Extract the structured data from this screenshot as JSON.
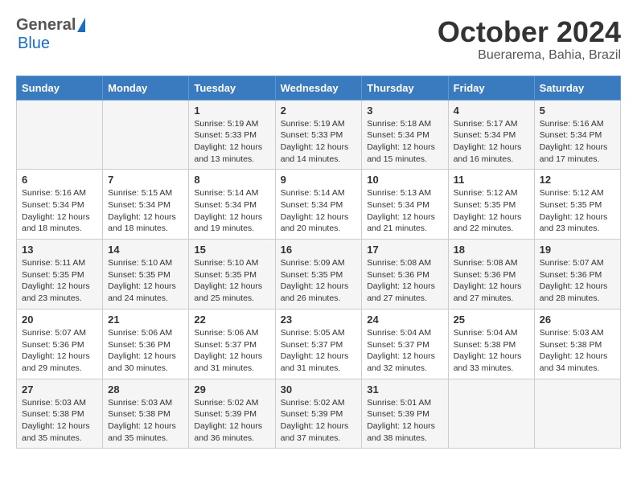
{
  "logo": {
    "general": "General",
    "blue": "Blue"
  },
  "header": {
    "title": "October 2024",
    "subtitle": "Buerarema, Bahia, Brazil"
  },
  "days_of_week": [
    "Sunday",
    "Monday",
    "Tuesday",
    "Wednesday",
    "Thursday",
    "Friday",
    "Saturday"
  ],
  "weeks": [
    [
      {
        "day": "",
        "sunrise": "",
        "sunset": "",
        "daylight": ""
      },
      {
        "day": "",
        "sunrise": "",
        "sunset": "",
        "daylight": ""
      },
      {
        "day": "1",
        "sunrise": "Sunrise: 5:19 AM",
        "sunset": "Sunset: 5:33 PM",
        "daylight": "Daylight: 12 hours and 13 minutes."
      },
      {
        "day": "2",
        "sunrise": "Sunrise: 5:19 AM",
        "sunset": "Sunset: 5:33 PM",
        "daylight": "Daylight: 12 hours and 14 minutes."
      },
      {
        "day": "3",
        "sunrise": "Sunrise: 5:18 AM",
        "sunset": "Sunset: 5:34 PM",
        "daylight": "Daylight: 12 hours and 15 minutes."
      },
      {
        "day": "4",
        "sunrise": "Sunrise: 5:17 AM",
        "sunset": "Sunset: 5:34 PM",
        "daylight": "Daylight: 12 hours and 16 minutes."
      },
      {
        "day": "5",
        "sunrise": "Sunrise: 5:16 AM",
        "sunset": "Sunset: 5:34 PM",
        "daylight": "Daylight: 12 hours and 17 minutes."
      }
    ],
    [
      {
        "day": "6",
        "sunrise": "Sunrise: 5:16 AM",
        "sunset": "Sunset: 5:34 PM",
        "daylight": "Daylight: 12 hours and 18 minutes."
      },
      {
        "day": "7",
        "sunrise": "Sunrise: 5:15 AM",
        "sunset": "Sunset: 5:34 PM",
        "daylight": "Daylight: 12 hours and 18 minutes."
      },
      {
        "day": "8",
        "sunrise": "Sunrise: 5:14 AM",
        "sunset": "Sunset: 5:34 PM",
        "daylight": "Daylight: 12 hours and 19 minutes."
      },
      {
        "day": "9",
        "sunrise": "Sunrise: 5:14 AM",
        "sunset": "Sunset: 5:34 PM",
        "daylight": "Daylight: 12 hours and 20 minutes."
      },
      {
        "day": "10",
        "sunrise": "Sunrise: 5:13 AM",
        "sunset": "Sunset: 5:34 PM",
        "daylight": "Daylight: 12 hours and 21 minutes."
      },
      {
        "day": "11",
        "sunrise": "Sunrise: 5:12 AM",
        "sunset": "Sunset: 5:35 PM",
        "daylight": "Daylight: 12 hours and 22 minutes."
      },
      {
        "day": "12",
        "sunrise": "Sunrise: 5:12 AM",
        "sunset": "Sunset: 5:35 PM",
        "daylight": "Daylight: 12 hours and 23 minutes."
      }
    ],
    [
      {
        "day": "13",
        "sunrise": "Sunrise: 5:11 AM",
        "sunset": "Sunset: 5:35 PM",
        "daylight": "Daylight: 12 hours and 23 minutes."
      },
      {
        "day": "14",
        "sunrise": "Sunrise: 5:10 AM",
        "sunset": "Sunset: 5:35 PM",
        "daylight": "Daylight: 12 hours and 24 minutes."
      },
      {
        "day": "15",
        "sunrise": "Sunrise: 5:10 AM",
        "sunset": "Sunset: 5:35 PM",
        "daylight": "Daylight: 12 hours and 25 minutes."
      },
      {
        "day": "16",
        "sunrise": "Sunrise: 5:09 AM",
        "sunset": "Sunset: 5:35 PM",
        "daylight": "Daylight: 12 hours and 26 minutes."
      },
      {
        "day": "17",
        "sunrise": "Sunrise: 5:08 AM",
        "sunset": "Sunset: 5:36 PM",
        "daylight": "Daylight: 12 hours and 27 minutes."
      },
      {
        "day": "18",
        "sunrise": "Sunrise: 5:08 AM",
        "sunset": "Sunset: 5:36 PM",
        "daylight": "Daylight: 12 hours and 27 minutes."
      },
      {
        "day": "19",
        "sunrise": "Sunrise: 5:07 AM",
        "sunset": "Sunset: 5:36 PM",
        "daylight": "Daylight: 12 hours and 28 minutes."
      }
    ],
    [
      {
        "day": "20",
        "sunrise": "Sunrise: 5:07 AM",
        "sunset": "Sunset: 5:36 PM",
        "daylight": "Daylight: 12 hours and 29 minutes."
      },
      {
        "day": "21",
        "sunrise": "Sunrise: 5:06 AM",
        "sunset": "Sunset: 5:36 PM",
        "daylight": "Daylight: 12 hours and 30 minutes."
      },
      {
        "day": "22",
        "sunrise": "Sunrise: 5:06 AM",
        "sunset": "Sunset: 5:37 PM",
        "daylight": "Daylight: 12 hours and 31 minutes."
      },
      {
        "day": "23",
        "sunrise": "Sunrise: 5:05 AM",
        "sunset": "Sunset: 5:37 PM",
        "daylight": "Daylight: 12 hours and 31 minutes."
      },
      {
        "day": "24",
        "sunrise": "Sunrise: 5:04 AM",
        "sunset": "Sunset: 5:37 PM",
        "daylight": "Daylight: 12 hours and 32 minutes."
      },
      {
        "day": "25",
        "sunrise": "Sunrise: 5:04 AM",
        "sunset": "Sunset: 5:38 PM",
        "daylight": "Daylight: 12 hours and 33 minutes."
      },
      {
        "day": "26",
        "sunrise": "Sunrise: 5:03 AM",
        "sunset": "Sunset: 5:38 PM",
        "daylight": "Daylight: 12 hours and 34 minutes."
      }
    ],
    [
      {
        "day": "27",
        "sunrise": "Sunrise: 5:03 AM",
        "sunset": "Sunset: 5:38 PM",
        "daylight": "Daylight: 12 hours and 35 minutes."
      },
      {
        "day": "28",
        "sunrise": "Sunrise: 5:03 AM",
        "sunset": "Sunset: 5:38 PM",
        "daylight": "Daylight: 12 hours and 35 minutes."
      },
      {
        "day": "29",
        "sunrise": "Sunrise: 5:02 AM",
        "sunset": "Sunset: 5:39 PM",
        "daylight": "Daylight: 12 hours and 36 minutes."
      },
      {
        "day": "30",
        "sunrise": "Sunrise: 5:02 AM",
        "sunset": "Sunset: 5:39 PM",
        "daylight": "Daylight: 12 hours and 37 minutes."
      },
      {
        "day": "31",
        "sunrise": "Sunrise: 5:01 AM",
        "sunset": "Sunset: 5:39 PM",
        "daylight": "Daylight: 12 hours and 38 minutes."
      },
      {
        "day": "",
        "sunrise": "",
        "sunset": "",
        "daylight": ""
      },
      {
        "day": "",
        "sunrise": "",
        "sunset": "",
        "daylight": ""
      }
    ]
  ]
}
